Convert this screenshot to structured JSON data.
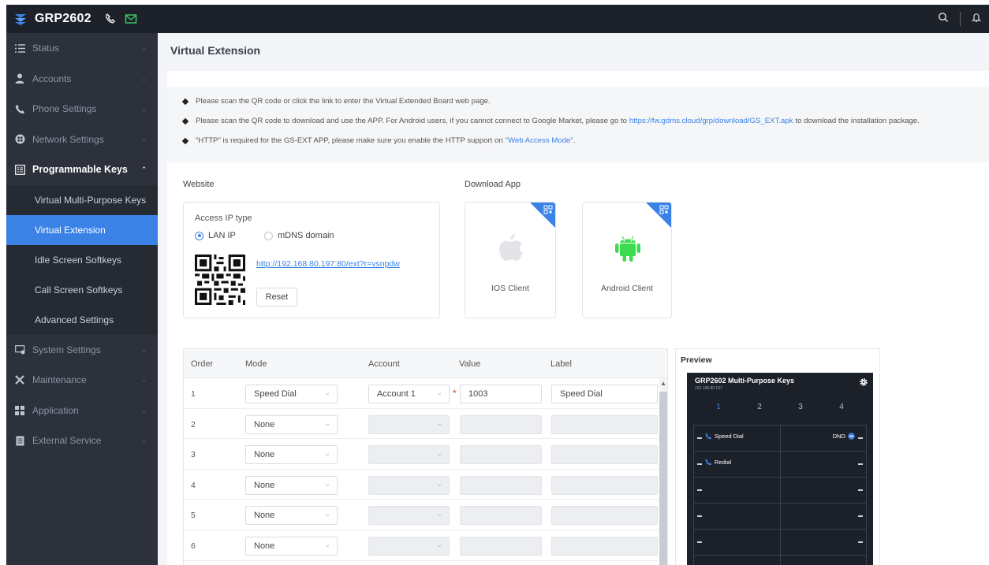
{
  "app": {
    "title": "GRP2602"
  },
  "sidebar": {
    "items": [
      {
        "label": "Status"
      },
      {
        "label": "Accounts"
      },
      {
        "label": "Phone Settings"
      },
      {
        "label": "Network Settings"
      },
      {
        "label": "Programmable Keys"
      },
      {
        "label": "System Settings"
      },
      {
        "label": "Maintenance"
      },
      {
        "label": "Application"
      },
      {
        "label": "External Service"
      }
    ],
    "subitems": [
      {
        "label": "Virtual Multi-Purpose Keys"
      },
      {
        "label": "Virtual Extension"
      },
      {
        "label": "Idle Screen Softkeys"
      },
      {
        "label": "Call Screen Softkeys"
      },
      {
        "label": "Advanced Settings"
      }
    ]
  },
  "page": {
    "title": "Virtual Extension",
    "notes": {
      "n1": "Please scan the QR code or click the link to enter the Virtual Extended Board web page.",
      "n2_pre": "Please scan the QR code to download and use the APP. For Android users, if you cannot connect to Google Market, please go to",
      "n2_link": "https://fw.gdms.cloud/grp/download/GS_EXT.apk",
      "n2_post": "to download the installation package.",
      "n3_pre": "\"HTTP\" is required for the GS-EXT APP, please make sure you enable the HTTP support on",
      "n3_link": "\"Web Access Mode\"",
      "n3_post": "."
    },
    "website": {
      "label": "Website",
      "access_ip_type": "Access IP type",
      "options": [
        "LAN IP",
        "mDNS domain"
      ],
      "selected": "LAN IP",
      "url": "http://192.168.80.197:80/ext?r=vsnpdw",
      "reset": "Reset"
    },
    "download": {
      "label": "Download App",
      "ios": "IOS Client",
      "android": "Android Client"
    },
    "table": {
      "headers": [
        "Order",
        "Mode",
        "Account",
        "Value",
        "Label"
      ],
      "rows": [
        {
          "order": "1",
          "mode": "Speed Dial",
          "account": "Account 1",
          "value": "1003",
          "label": "Speed Dial"
        },
        {
          "order": "2",
          "mode": "None",
          "account": "",
          "value": "",
          "label": ""
        },
        {
          "order": "3",
          "mode": "None",
          "account": "",
          "value": "",
          "label": ""
        },
        {
          "order": "4",
          "mode": "None",
          "account": "",
          "value": "",
          "label": ""
        },
        {
          "order": "5",
          "mode": "None",
          "account": "",
          "value": "",
          "label": ""
        },
        {
          "order": "6",
          "mode": "None",
          "account": "",
          "value": "",
          "label": ""
        }
      ]
    },
    "preview": {
      "title": "Preview",
      "phone_title": "GRP2602 Multi-Purpose Keys",
      "phone_ip": "192.168.80.197",
      "tabs": [
        "1",
        "2",
        "3",
        "4"
      ],
      "key1": "Speed Dial",
      "key1_right": "DND",
      "key2": "Redial"
    }
  },
  "colors": {
    "accent": "#3b82e6",
    "topbar": "#1d212a",
    "sidebar": "#2c313c"
  }
}
